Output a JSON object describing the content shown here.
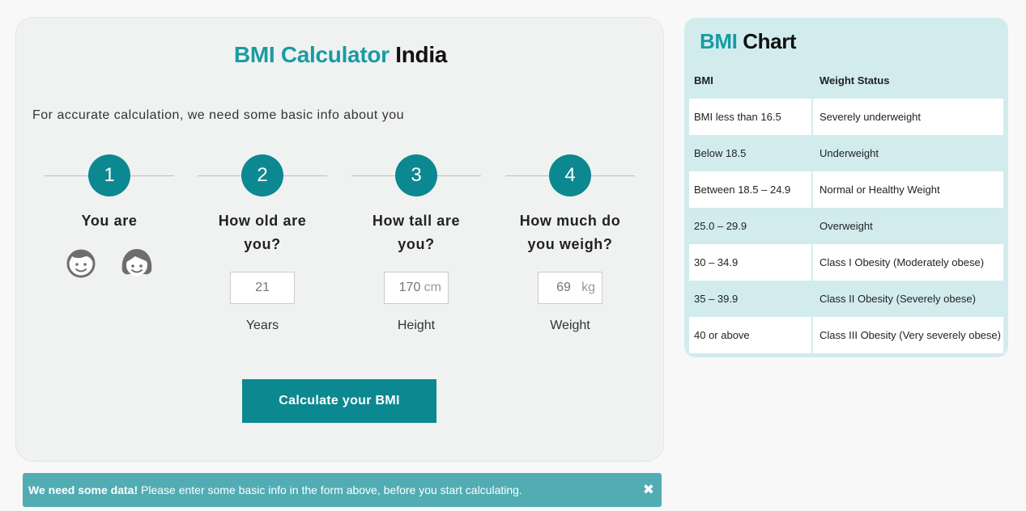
{
  "calculator": {
    "title_accent": "BMI Calculator",
    "title_rest": "India",
    "intro": "For accurate calculation, we need some basic info about you",
    "steps": [
      {
        "number": "1",
        "question_line1": "You are",
        "question_line2": ""
      },
      {
        "number": "2",
        "question_line1": "How old are",
        "question_line2": "you?",
        "value": "21",
        "unit": "",
        "sublabel": "Years"
      },
      {
        "number": "3",
        "question_line1": "How tall are",
        "question_line2": "you?",
        "value": "170",
        "unit": "cm",
        "sublabel": "Height"
      },
      {
        "number": "4",
        "question_line1": "How much do",
        "question_line2": "you weigh?",
        "value": "69",
        "unit": "kg",
        "sublabel": "Weight"
      }
    ],
    "button_label": "Calculate your BMI"
  },
  "notice": {
    "bold": "We need some data!",
    "text": " Please enter some basic info in the form above, before you start calculating.",
    "close": "✖"
  },
  "chart": {
    "title_accent": "BMI",
    "title_rest": "Chart",
    "headers": [
      "BMI",
      "Weight Status"
    ],
    "rows": [
      {
        "bmi": "BMI less than 16.5",
        "status": "Severely underweight"
      },
      {
        "bmi": "Below 18.5",
        "status": "Underweight"
      },
      {
        "bmi": "Between 18.5 – 24.9",
        "status": "Normal or Healthy Weight"
      },
      {
        "bmi": "25.0 – 29.9",
        "status": "Overweight"
      },
      {
        "bmi": "30 – 34.9",
        "status": "Class I Obesity (Moderately obese)"
      },
      {
        "bmi": "35 – 39.9",
        "status": "Class II Obesity (Severely obese)"
      },
      {
        "bmi": "40 or above",
        "status": "Class III Obesity (Very severely obese)"
      }
    ]
  },
  "colors": {
    "accent": "#1a9ba3",
    "button": "#0c8891",
    "notice": "#51acb4",
    "chart_bg": "#d2ecee"
  },
  "icons": {
    "male": "male-face-icon",
    "female": "female-face-icon",
    "close": "close-icon"
  }
}
